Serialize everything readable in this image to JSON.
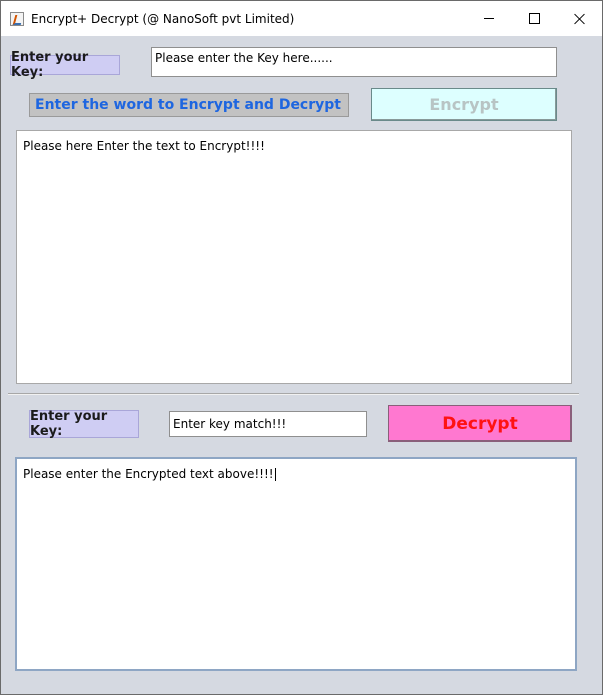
{
  "window": {
    "title": "Encrypt+ Decrypt (@ NanoSoft pvt Limited)",
    "controls": {
      "minimize": "minimize",
      "maximize": "maximize",
      "close": "close"
    }
  },
  "encrypt_section": {
    "key_label": "Enter your Key:",
    "key_input_value": "Please enter the Key here......",
    "banner": "Enter the word to Encrypt and Decrypt",
    "encrypt_button": "Encrypt",
    "text_area_value": "Please here Enter the text to Encrypt!!!!"
  },
  "decrypt_section": {
    "key_label": "Enter your Key:",
    "key_input_value": "Enter key match!!!",
    "decrypt_button": "Decrypt",
    "text_area_value": "Please enter the Encrypted text above!!!!"
  },
  "colors": {
    "window_bg": "#d5d9e1",
    "key_label_bg": "#cfcdf3",
    "banner_text": "#1e66e0",
    "encrypt_button_bg": "#ddffff",
    "decrypt_button_bg": "#ff78d0",
    "decrypt_button_text": "#ff1212"
  }
}
